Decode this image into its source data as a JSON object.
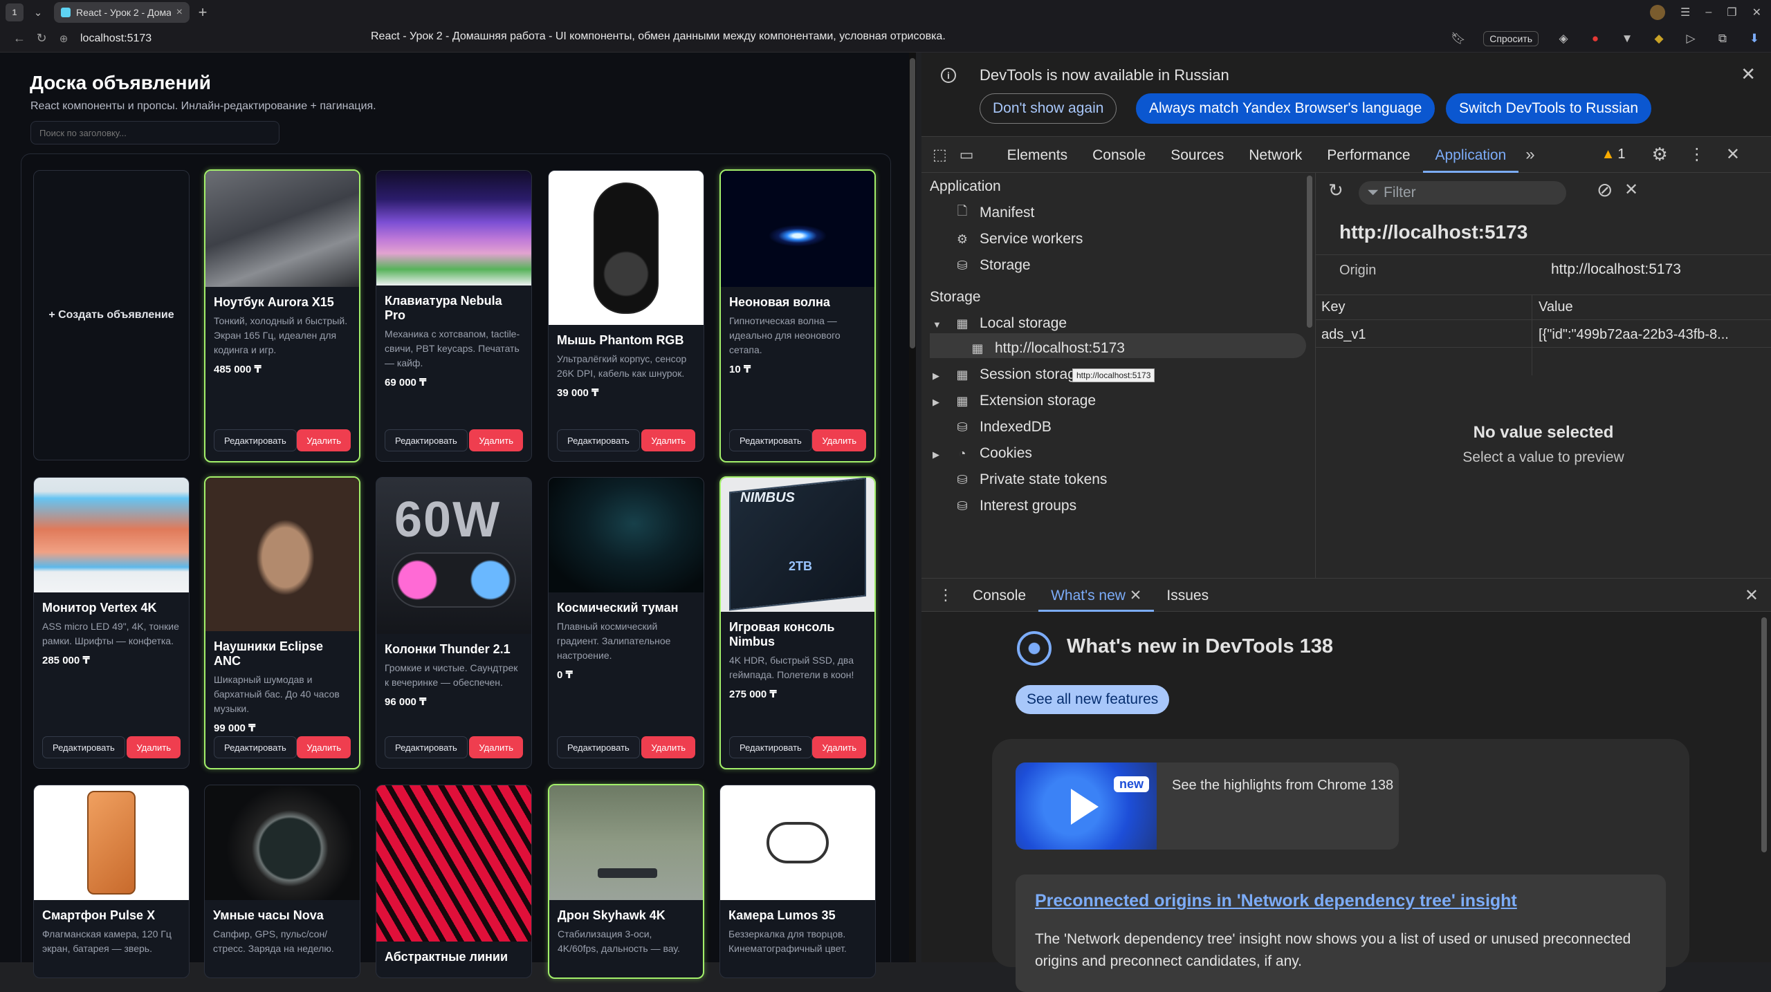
{
  "browser": {
    "tab_title": "React - Урок 2 - Домаш",
    "tab_count": "1",
    "url": "localhost:5173",
    "page_title": "React - Урок 2 - Домашняя работа - UI компоненты, обмен данными между компонентами, условная отрисовка.",
    "ask_label": "Спросить"
  },
  "app": {
    "title": "Доска объявлений",
    "subtitle": "React компоненты и пропсы. Инлайн-редактирование + пагинация.",
    "search_placeholder": "Поиск по заголовку...",
    "create_label": "+ Создать объявление",
    "edit_label": "Редактировать",
    "delete_label": "Удалить"
  },
  "cards": [
    {
      "title": "Ноутбук Aurora X15",
      "desc": "Тонкий, холодный и быстрый. Экран 165 Гц, идеален для кодинга и игр.",
      "price": "485 000 ₸",
      "highlighted": true
    },
    {
      "title": "Клавиатура Nebula Pro",
      "desc": "Механика с хотсвапом, tactile-свичи, PBT keycaps. Печатать — кайф.",
      "price": "69 000 ₸",
      "highlighted": false
    },
    {
      "title": "Мышь Phantom RGB",
      "desc": "Ультралёгкий корпус, сенсор 26K DPI, кабель как шнурок.",
      "price": "39 000 ₸",
      "highlighted": false
    },
    {
      "title": "Неоновая волна",
      "desc": "Гипнотическая волна — идеально для неонового сетапа.",
      "price": "10 ₸",
      "highlighted": true
    },
    {
      "title": "Монитор Vertex 4K",
      "desc": "ASS micro LED 49\", 4K, тонкие рамки. Шрифты — конфетка.",
      "price": "285 000 ₸",
      "highlighted": false
    },
    {
      "title": "Наушники Eclipse ANC",
      "desc": "Шикарный шумодав и бархатный бас. До 40 часов музыки.",
      "price": "99 000 ₸",
      "highlighted": true
    },
    {
      "title": "Колонки Thunder 2.1",
      "desc": "Громкие и чистые. Саундтрек к вечеринке — обеспечен.",
      "price": "96 000 ₸",
      "highlighted": false
    },
    {
      "title": "Космический туман",
      "desc": "Плавный космический градиент. Залипательное настроение.",
      "price": "0 ₸",
      "highlighted": false
    },
    {
      "title": "Игровая консоль Nimbus",
      "desc": "4K HDR, быстрый SSD, два геймпада. Полетели в коон!",
      "price": "275 000 ₸",
      "highlighted": true
    },
    {
      "title": "Смартфон Pulse X",
      "desc": "Флагманская камера, 120 Гц экран, батарея — зверь.",
      "price": "",
      "highlighted": false
    },
    {
      "title": "Умные часы Nova",
      "desc": "Сапфир, GPS, пульс/сон/стресс. Заряда на неделю.",
      "price": "",
      "highlighted": false
    },
    {
      "title": "Абстрактные линии",
      "desc": "",
      "price": "",
      "highlighted": false
    },
    {
      "title": "Дрон Skyhawk 4K",
      "desc": "Стабилизация 3-оси, 4K/60fps, дальность — вау.",
      "price": "",
      "highlighted": true
    },
    {
      "title": "Камера Lumos 35",
      "desc": "Беззеркалка для творцов. Кинематографичный цвет.",
      "price": "",
      "highlighted": false
    }
  ],
  "image_texts": {
    "speaker": "60W",
    "console_brand": "NIMBUS",
    "console_label": "2TB"
  },
  "devtools": {
    "info_message": "DevTools is now available in Russian",
    "btn_dont_show": "Don't show again",
    "btn_always_match": "Always match Yandex Browser's language",
    "btn_switch": "Switch DevTools to Russian",
    "tabs": [
      "Elements",
      "Console",
      "Sources",
      "Network",
      "Performance",
      "Application"
    ],
    "warning_count": "1",
    "sidebar": {
      "app_header": "Application",
      "manifest": "Manifest",
      "service_workers": "Service workers",
      "storage": "Storage",
      "storage_header": "Storage",
      "local_storage": "Local storage",
      "local_origin": "http://localhost:5173",
      "session_storage": "Session storage",
      "extension_storage": "Extension storage",
      "indexeddb": "IndexedDB",
      "cookies": "Cookies",
      "private_state_tokens": "Private state tokens",
      "interest_groups": "Interest groups"
    },
    "tooltip": "http://localhost:5173",
    "filter_placeholder": "Filter",
    "origin_title": "http://localhost:5173",
    "origin_label": "Origin",
    "origin_value": "http://localhost:5173",
    "col_key": "Key",
    "col_value": "Value",
    "row_key": "ads_v1",
    "row_value": "[{\"id\":\"499b72aa-22b3-43fb-8...",
    "no_value": "No value selected",
    "no_value_hint": "Select a value to preview",
    "drawer_tabs": [
      "Console",
      "What's new",
      "Issues"
    ],
    "whats_new_title": "What's new in DevTools 138",
    "see_all": "See all new features",
    "video_badge": "new",
    "highlights": "See the highlights from Chrome 138",
    "article_title": "Preconnected origins in 'Network dependency tree' insight",
    "article_text": "The 'Network dependency tree' insight now shows you a list of used or unused preconnected origins and preconnect candidates, if any."
  },
  "colors": {
    "accent": "#a3f06a",
    "danger": "#ef3e4f",
    "devtools_blue": "#7cacf8"
  }
}
